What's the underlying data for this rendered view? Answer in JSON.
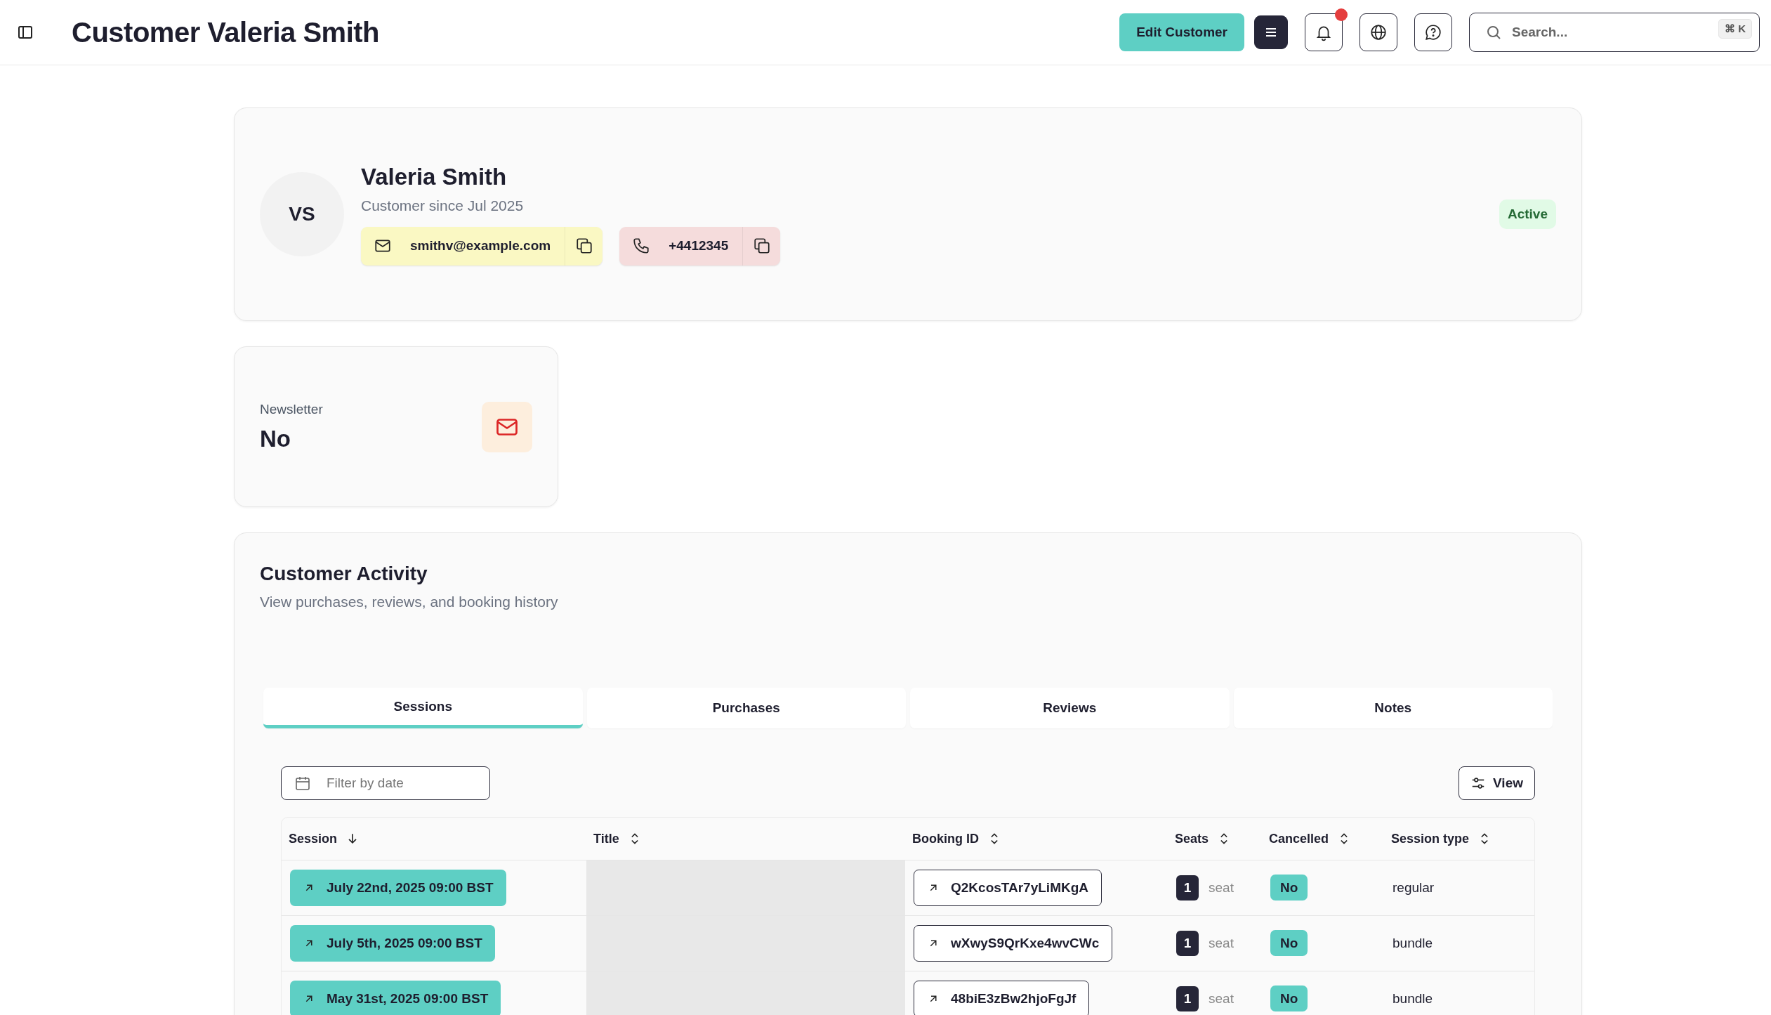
{
  "header": {
    "title": "Customer Valeria Smith",
    "edit_button": "Edit Customer",
    "notifications": {
      "unread": true
    },
    "search": {
      "placeholder": "Search...",
      "shortcut": "⌘ K"
    }
  },
  "profile": {
    "initials": "VS",
    "name": "Valeria Smith",
    "since": "Customer since Jul 2025",
    "email": "smithv@example.com",
    "phone": "+4412345",
    "status": "Active"
  },
  "newsletter": {
    "label": "Newsletter",
    "value": "No"
  },
  "activity": {
    "title": "Customer Activity",
    "subtitle": "View purchases, reviews, and booking history",
    "tabs": [
      {
        "label": "Sessions",
        "selected": true
      },
      {
        "label": "Purchases",
        "selected": false
      },
      {
        "label": "Reviews",
        "selected": false
      },
      {
        "label": "Notes",
        "selected": false
      }
    ],
    "filter": {
      "placeholder": "Filter by date"
    },
    "view_button": "View",
    "table": {
      "columns": [
        {
          "label": "Session",
          "sorted": true
        },
        {
          "label": "Title",
          "sorted": false
        },
        {
          "label": "Booking ID",
          "sorted": false
        },
        {
          "label": "Seats",
          "sorted": false
        },
        {
          "label": "Cancelled",
          "sorted": false
        },
        {
          "label": "Session type",
          "sorted": false
        }
      ],
      "rows": [
        {
          "session": "July 22nd, 2025 09:00 BST",
          "booking_id": "Q2KcosTAr7yLiMKgA",
          "seats": "1",
          "seats_unit": "seat",
          "cancelled": "No",
          "session_type": "regular"
        },
        {
          "session": "July 5th, 2025 09:00 BST",
          "booking_id": "wXwyS9QrKxe4wvCWc",
          "seats": "1",
          "seats_unit": "seat",
          "cancelled": "No",
          "session_type": "bundle"
        },
        {
          "session": "May 31st, 2025 09:00 BST",
          "booking_id": "48biE3zBw2hjoFgJf",
          "seats": "1",
          "seats_unit": "seat",
          "cancelled": "No",
          "session_type": "bundle"
        }
      ]
    }
  }
}
